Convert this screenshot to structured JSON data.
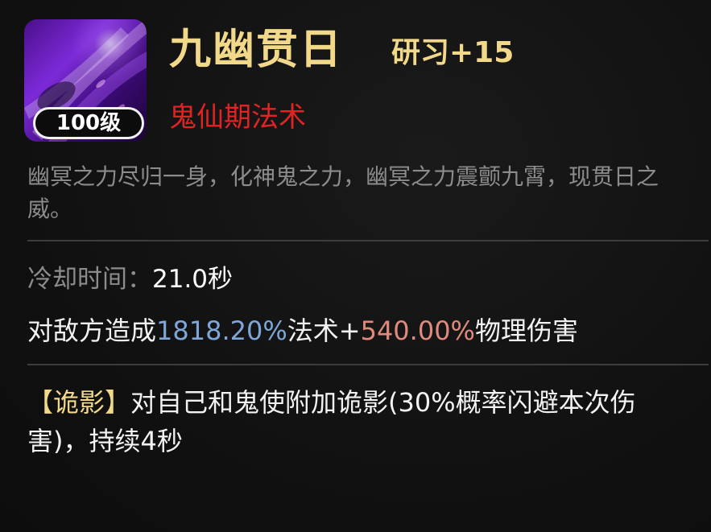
{
  "skill": {
    "name": "九幽贯日",
    "study_bonus": "研习+15",
    "category": "鬼仙期法术",
    "level": "100级",
    "icon": "purple-slash-skill-icon",
    "description": "幽冥之力尽归一身，化神鬼之力，幽冥之力震颤九霄，现贯日之威。"
  },
  "cooldown": {
    "label": "冷却时间：",
    "value": "21.0秒"
  },
  "damage": {
    "prefix": "对敌方造成",
    "magic_value": "1818.20%",
    "magic_label": "法术",
    "plus": "+",
    "phys_value": "540.00%",
    "suffix": "物理伤害"
  },
  "effect": {
    "tag": "【诡影】",
    "text": "对自己和鬼使附加诡影(30%概率闪避本次伤害)，持续4秒"
  },
  "colors": {
    "gold": "#f2d889",
    "category_red": "#e02424",
    "magic_blue": "#7ea6d6",
    "phys_red": "#e08a7e",
    "muted_gray": "#8c8c8c"
  }
}
